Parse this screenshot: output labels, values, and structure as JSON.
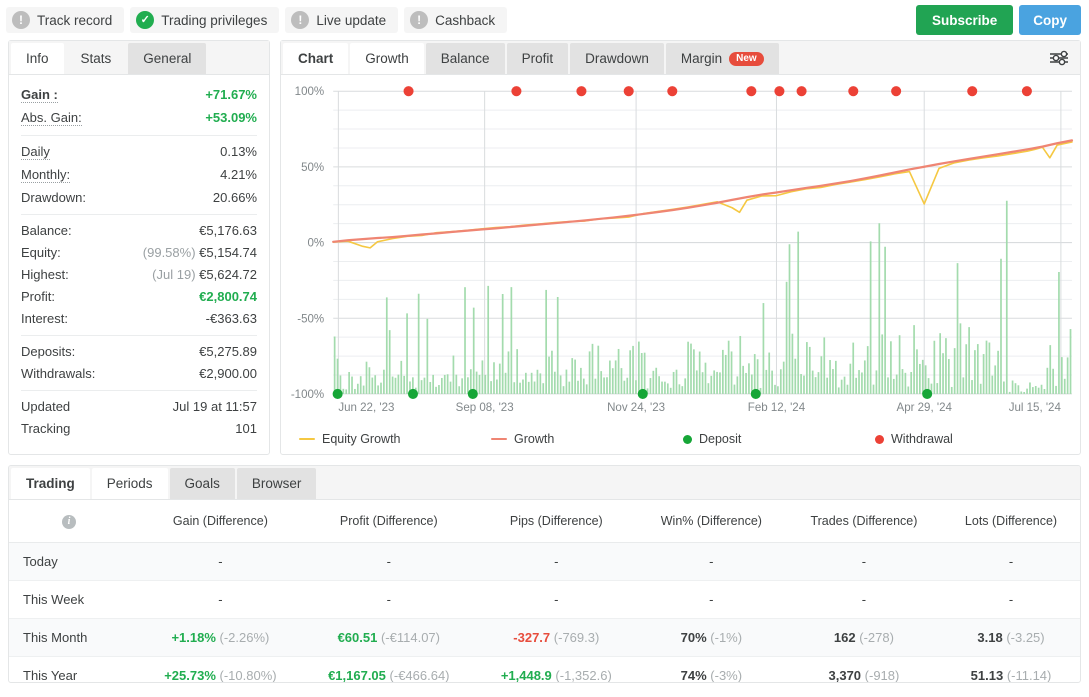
{
  "topbar": {
    "chips": [
      {
        "label": "Track record",
        "icon": "exclamation-icon",
        "state": "grey"
      },
      {
        "label": "Trading privileges",
        "icon": "check-circle-icon",
        "state": "green"
      },
      {
        "label": "Live update",
        "icon": "exclamation-icon",
        "state": "grey"
      },
      {
        "label": "Cashback",
        "icon": "exclamation-icon",
        "state": "grey"
      }
    ],
    "subscribe_label": "Subscribe",
    "copy_label": "Copy"
  },
  "left_panel": {
    "tabs": [
      {
        "label": "Info",
        "active": true
      },
      {
        "label": "Stats",
        "active": false
      },
      {
        "label": "General",
        "active": false
      }
    ],
    "groups": [
      [
        {
          "label": "Gain :",
          "value": "+71.67%",
          "value_class": "green",
          "label_bold": true
        },
        {
          "label": "Abs. Gain:",
          "value": "+53.09%",
          "value_class": "green"
        }
      ],
      [
        {
          "label": "Daily",
          "value": "0.13%"
        },
        {
          "label": "Monthly:",
          "value": "4.21%"
        },
        {
          "label": "Drawdown:",
          "value": "20.66%"
        }
      ],
      [
        {
          "label": "Balance:",
          "value": "€5,176.63"
        },
        {
          "label": "Equity:",
          "prefix": "(99.58%)",
          "value": "€5,154.74"
        },
        {
          "label": "Highest:",
          "prefix": "(Jul 19)",
          "value": "€5,624.72"
        },
        {
          "label": "Profit:",
          "value": "€2,800.74",
          "value_class": "green"
        },
        {
          "label": "Interest:",
          "value": "-€363.63"
        }
      ],
      [
        {
          "label": "Deposits:",
          "value": "€5,275.89"
        },
        {
          "label": "Withdrawals:",
          "value": "€2,900.00"
        }
      ],
      [
        {
          "label": "Updated",
          "value": "Jul 19 at 11:57",
          "no_dots": true
        },
        {
          "label": "Tracking",
          "value": "101",
          "no_dots": true
        }
      ]
    ]
  },
  "chart_panel": {
    "tabs": [
      {
        "label": "Chart",
        "active": true,
        "bold": true
      },
      {
        "label": "Growth",
        "active": true
      },
      {
        "label": "Balance",
        "active": false
      },
      {
        "label": "Profit",
        "active": false
      },
      {
        "label": "Drawdown",
        "active": false
      },
      {
        "label": "Margin",
        "active": false,
        "badge": "New"
      }
    ],
    "settings_icon": "sliders-icon",
    "legend": [
      {
        "label": "Equity Growth",
        "type": "line",
        "color": "#f5c842"
      },
      {
        "label": "Growth",
        "type": "line",
        "color": "#ef8573"
      },
      {
        "label": "Deposit",
        "type": "dot",
        "color": "#16a637"
      },
      {
        "label": "Withdrawal",
        "type": "dot",
        "color": "#ec4136"
      }
    ]
  },
  "chart_data": {
    "type": "line",
    "title": "Growth",
    "xlabel": "",
    "ylabel": "",
    "ylim": [
      -100,
      100
    ],
    "yticks": [
      100,
      50,
      0,
      -50,
      -100
    ],
    "ytick_labels": [
      "100%",
      "50%",
      "0%",
      "-50%",
      "-100%"
    ],
    "grid": true,
    "legend_position": "bottom",
    "xticks": [
      "Jun 22, '23",
      "Sep 08, '23",
      "Nov 24, '23",
      "Feb 12, '24",
      "Apr 29, '24",
      "Jul 15, '24"
    ],
    "xtick_positions_pct": [
      0.7,
      20.5,
      41.0,
      60.0,
      80.0,
      98.5
    ],
    "series": [
      {
        "name": "Growth",
        "color": "#ef8573",
        "type": "line",
        "x_pct": [
          0,
          2,
          4,
          6,
          8,
          10,
          12,
          14,
          16,
          18,
          20,
          22,
          24,
          26,
          28,
          30,
          32,
          34,
          36,
          38,
          40,
          42,
          44,
          46,
          48,
          50,
          52,
          54,
          56,
          58,
          60,
          62,
          64,
          66,
          68,
          70,
          72,
          74,
          76,
          78,
          80,
          82,
          84,
          86,
          88,
          90,
          92,
          94,
          96,
          98,
          100
        ],
        "values": [
          0.5,
          1.5,
          2.3,
          3.0,
          3.6,
          4.4,
          5.3,
          6.1,
          7.0,
          7.8,
          8.6,
          9.4,
          10.3,
          11.1,
          12.0,
          12.8,
          13.7,
          14.6,
          15.6,
          16.6,
          17.7,
          18.9,
          20.2,
          21.5,
          23.0,
          24.6,
          26.3,
          28.2,
          30.0,
          31.7,
          33.1,
          34.6,
          36.1,
          37.5,
          39.0,
          40.6,
          42.4,
          44.3,
          46.3,
          48.3,
          50.1,
          51.9,
          53.6,
          55.2,
          56.8,
          58.4,
          60.0,
          61.6,
          63.4,
          65.6,
          67.5
        ]
      },
      {
        "name": "Equity Growth",
        "color": "#f5c842",
        "type": "line",
        "x_pct": [
          0,
          2,
          4,
          5,
          6,
          8,
          10,
          12,
          14,
          16,
          18,
          20,
          22,
          24,
          26,
          28,
          30,
          32,
          34,
          36,
          38,
          40,
          42,
          44,
          46,
          48,
          50,
          52,
          54,
          55,
          56,
          58,
          60,
          62,
          64,
          66,
          68,
          70,
          72,
          74,
          76,
          78,
          80,
          82,
          84,
          86,
          88,
          90,
          92,
          94,
          95,
          96,
          97,
          98,
          100
        ],
        "values": [
          0.3,
          0.9,
          -2.5,
          -3.5,
          0.5,
          2.6,
          4.1,
          4.7,
          6.5,
          7.2,
          8.0,
          9.0,
          9.9,
          10.5,
          11.6,
          12.3,
          13.2,
          13.9,
          14.2,
          15.7,
          16.2,
          16.8,
          19.2,
          20.6,
          22.0,
          23.5,
          25.2,
          26.9,
          23.0,
          20.0,
          28.0,
          30.8,
          31.0,
          33.6,
          35.5,
          36.4,
          38.4,
          40.0,
          41.6,
          43.4,
          45.4,
          46.9,
          25.5,
          49.0,
          52.6,
          54.5,
          56.0,
          57.2,
          58.8,
          60.4,
          61.6,
          63.0,
          56.0,
          64.4,
          66.5
        ]
      },
      {
        "name": "Daily Bars",
        "color": "#9ed9a9",
        "type": "bar",
        "baseline": -100,
        "note": "dense daily volume bars rising from the -100% baseline"
      }
    ],
    "deposits": {
      "label": "Deposit",
      "color": "#16a637",
      "y": -100,
      "x_pct": [
        0.6,
        10.8,
        18.9,
        41.9,
        57.2,
        80.4
      ]
    },
    "withdrawals": {
      "label": "Withdrawal",
      "color": "#ec4136",
      "y": 100,
      "x_pct": [
        10.2,
        24.8,
        33.6,
        40.0,
        45.9,
        56.6,
        60.4,
        63.4,
        70.4,
        76.2,
        86.5,
        93.9
      ]
    }
  },
  "bottom": {
    "tabs": [
      {
        "label": "Trading",
        "active": true,
        "bold": true
      },
      {
        "label": "Periods",
        "active": true
      },
      {
        "label": "Goals",
        "active": false
      },
      {
        "label": "Browser",
        "active": false
      }
    ],
    "columns": [
      "",
      "Gain (Difference)",
      "Profit (Difference)",
      "Pips (Difference)",
      "Win% (Difference)",
      "Trades (Difference)",
      "Lots (Difference)"
    ],
    "info_icon": "info-icon",
    "rows": [
      {
        "period": "Today",
        "cells": [
          {
            "main": "-",
            "diff": "",
            "cls": "plain"
          },
          {
            "main": "-",
            "diff": "",
            "cls": "plain"
          },
          {
            "main": "-",
            "diff": "",
            "cls": "plain"
          },
          {
            "main": "-",
            "diff": "",
            "cls": "plain"
          },
          {
            "main": "-",
            "diff": "",
            "cls": "plain"
          },
          {
            "main": "-",
            "diff": "",
            "cls": "plain"
          }
        ]
      },
      {
        "period": "This Week",
        "cells": [
          {
            "main": "-",
            "diff": "",
            "cls": "plain"
          },
          {
            "main": "-",
            "diff": "",
            "cls": "plain"
          },
          {
            "main": "-",
            "diff": "",
            "cls": "plain"
          },
          {
            "main": "-",
            "diff": "",
            "cls": "plain"
          },
          {
            "main": "-",
            "diff": "",
            "cls": "plain"
          },
          {
            "main": "-",
            "diff": "",
            "cls": "plain"
          }
        ]
      },
      {
        "period": "This Month",
        "cells": [
          {
            "main": "+1.18%",
            "diff": "(-2.26%)",
            "cls": "pos"
          },
          {
            "main": "€60.51",
            "diff": "(-€114.07)",
            "cls": "pos"
          },
          {
            "main": "-327.7",
            "diff": "(-769.3)",
            "cls": "neg"
          },
          {
            "main": "70%",
            "diff": "(-1%)",
            "cls": "neu"
          },
          {
            "main": "162",
            "diff": "(-278)",
            "cls": "neu"
          },
          {
            "main": "3.18",
            "diff": "(-3.25)",
            "cls": "neu"
          }
        ]
      },
      {
        "period": "This Year",
        "cells": [
          {
            "main": "+25.73%",
            "diff": "(-10.80%)",
            "cls": "pos"
          },
          {
            "main": "€1,167.05",
            "diff": "(-€466.64)",
            "cls": "pos"
          },
          {
            "main": "+1,448.9",
            "diff": "(-1,352.6)",
            "cls": "pos"
          },
          {
            "main": "74%",
            "diff": "(-3%)",
            "cls": "neu"
          },
          {
            "main": "3,370",
            "diff": "(-918)",
            "cls": "neu"
          },
          {
            "main": "51.13",
            "diff": "(-11.14)",
            "cls": "neu"
          }
        ]
      }
    ]
  }
}
